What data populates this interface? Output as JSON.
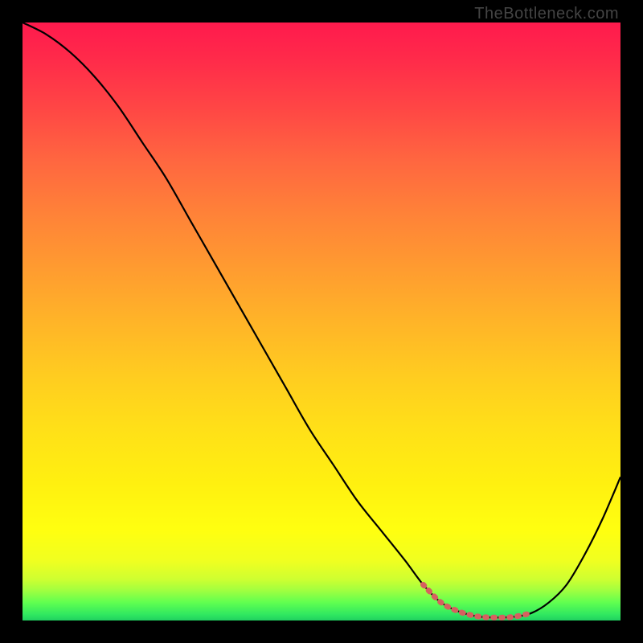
{
  "attribution": "TheBottleneck.com",
  "colors": {
    "background": "#000000",
    "curve_main": "#000000",
    "curve_highlight": "#d66060",
    "gradient_top": "#ff1a4d",
    "gradient_bottom": "#20d060"
  },
  "chart_data": {
    "type": "line",
    "title": "",
    "xlabel": "",
    "ylabel": "",
    "xlim": [
      0,
      100
    ],
    "ylim": [
      0,
      100
    ],
    "grid": false,
    "series": [
      {
        "name": "bottleneck-curve",
        "x": [
          0,
          4,
          8,
          12,
          16,
          20,
          24,
          28,
          32,
          36,
          40,
          44,
          48,
          52,
          56,
          60,
          64,
          67,
          70,
          73,
          76,
          79,
          82,
          85,
          88,
          91,
          94,
          97,
          100
        ],
        "values": [
          100,
          98,
          95,
          91,
          86,
          80,
          74,
          67,
          60,
          53,
          46,
          39,
          32,
          26,
          20,
          15,
          10,
          6,
          3,
          1.5,
          0.7,
          0.5,
          0.6,
          1.2,
          3,
          6,
          11,
          17,
          24
        ]
      }
    ],
    "highlight_zone": {
      "x_start": 67,
      "x_end": 85,
      "description": "optimal zone (trough)"
    },
    "background_gradient": {
      "orientation": "vertical",
      "stops": [
        {
          "pos": 0.0,
          "color": "#ff1a4d"
        },
        {
          "pos": 0.5,
          "color": "#ffb428"
        },
        {
          "pos": 0.85,
          "color": "#ffff10"
        },
        {
          "pos": 1.0,
          "color": "#20d060"
        }
      ]
    }
  }
}
